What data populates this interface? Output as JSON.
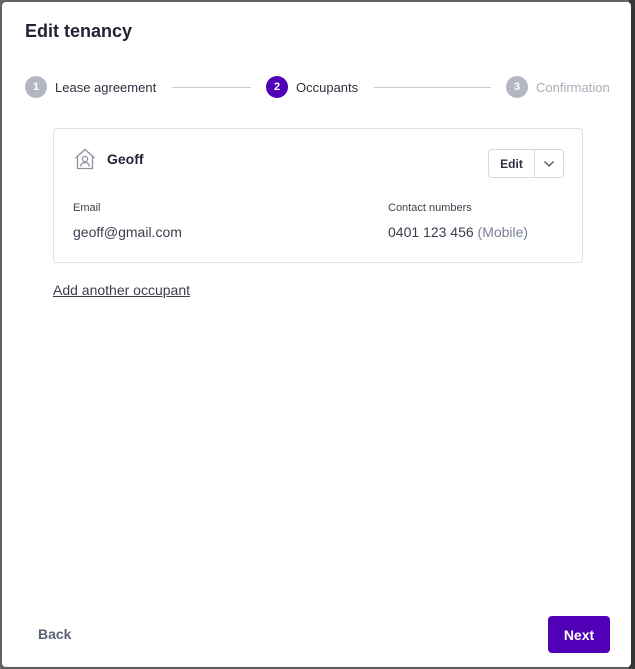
{
  "modal": {
    "title": "Edit tenancy"
  },
  "stepper": {
    "steps": [
      {
        "number": "1",
        "label": "Lease agreement",
        "state": "done"
      },
      {
        "number": "2",
        "label": "Occupants",
        "state": "active"
      },
      {
        "number": "3",
        "label": "Confirmation",
        "state": "pending"
      }
    ]
  },
  "occupant": {
    "name": "Geoff",
    "icon": "house-person-icon",
    "edit_label": "Edit",
    "email_label": "Email",
    "email": "geoff@gmail.com",
    "contact_label": "Contact numbers",
    "phone": "0401 123 456",
    "phone_type": "(Mobile)"
  },
  "add_occupant_label": "Add another occupant",
  "footer": {
    "back_label": "Back",
    "next_label": "Next"
  },
  "colors": {
    "accent": "#5200b8",
    "muted_step": "#b3b7c2"
  }
}
